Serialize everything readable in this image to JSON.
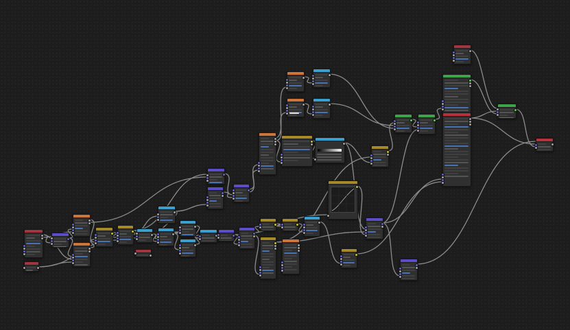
{
  "editor": {
    "colors": {
      "background": "#1d1d1d",
      "node_body": "#303030",
      "link": "#8c8c8c",
      "header_input": "#a23640",
      "header_texture": "#d0753a",
      "header_vector": "#5b4ec8",
      "header_converter": "#3aa0d0",
      "header_color": "#a68a2a",
      "header_shader": "#3ea34a",
      "header_output": "#b6323c"
    },
    "socket_colors": {
      "float": "#a1a1a1",
      "vector": "#6363c7",
      "color": "#c7c729",
      "shader": "#63c763"
    }
  },
  "nodes": [
    {
      "id": "n_input_1",
      "kind": "input"
    },
    {
      "id": "n_input_2",
      "kind": "input"
    },
    {
      "id": "n_vec_1",
      "kind": "vector"
    },
    {
      "id": "n_tex_1",
      "kind": "texture"
    },
    {
      "id": "n_tex_2",
      "kind": "texture"
    },
    {
      "id": "n_col_1",
      "kind": "color"
    },
    {
      "id": "n_col_2",
      "kind": "color"
    },
    {
      "id": "n_conv_1",
      "kind": "converter"
    },
    {
      "id": "n_input_3",
      "kind": "input"
    },
    {
      "id": "n_conv_2",
      "kind": "converter"
    },
    {
      "id": "n_conv_3",
      "kind": "converter"
    },
    {
      "id": "n_conv_4",
      "kind": "converter"
    },
    {
      "id": "n_conv_5",
      "kind": "converter"
    },
    {
      "id": "n_vec_2",
      "kind": "vector"
    },
    {
      "id": "n_vec_3",
      "kind": "vector"
    },
    {
      "id": "n_conv_6",
      "kind": "converter"
    },
    {
      "id": "n_vec_4",
      "kind": "vector"
    },
    {
      "id": "n_vec_5",
      "kind": "vector"
    },
    {
      "id": "n_vec_6",
      "kind": "vector"
    },
    {
      "id": "n_tex_3",
      "kind": "texture"
    },
    {
      "id": "n_col_3",
      "kind": "color"
    },
    {
      "id": "n_col_4",
      "kind": "color"
    },
    {
      "id": "n_curves",
      "kind": "color"
    },
    {
      "id": "n_conv_7",
      "kind": "converter"
    },
    {
      "id": "n_tex_4",
      "kind": "texture"
    },
    {
      "id": "n_tex_5",
      "kind": "texture"
    },
    {
      "id": "n_tex_6",
      "kind": "texture"
    },
    {
      "id": "n_conv_8",
      "kind": "converter"
    },
    {
      "id": "n_conv_9",
      "kind": "converter"
    },
    {
      "id": "n_col_5",
      "kind": "color"
    },
    {
      "id": "n_ramp",
      "kind": "converter"
    },
    {
      "id": "n_col_6",
      "kind": "color"
    },
    {
      "id": "n_col_7",
      "kind": "color"
    },
    {
      "id": "n_col_8",
      "kind": "color"
    },
    {
      "id": "n_vec_7",
      "kind": "vector"
    },
    {
      "id": "n_input_4",
      "kind": "input"
    },
    {
      "id": "n_bsdf_1",
      "kind": "shader"
    },
    {
      "id": "n_bsdf_2",
      "kind": "shader"
    },
    {
      "id": "n_mix_shader",
      "kind": "shader"
    },
    {
      "id": "n_output",
      "kind": "output"
    }
  ]
}
